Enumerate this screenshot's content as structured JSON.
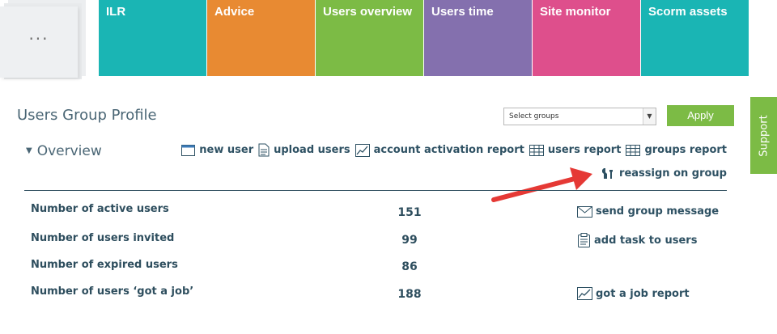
{
  "menu": {
    "dots": "..."
  },
  "tiles": [
    {
      "label": "ILR",
      "color": "#1ab5b4"
    },
    {
      "label": "Advice",
      "color": "#e88a32"
    },
    {
      "label": "Users overview",
      "color": "#7cbb45"
    },
    {
      "label": "Users time",
      "color": "#8470ae"
    },
    {
      "label": "Site monitor",
      "color": "#de4f8c"
    },
    {
      "label": "Scorm assets",
      "color": "#1ab5b4"
    }
  ],
  "header": {
    "title": "Users Group Profile",
    "select_value": "Select groups",
    "apply_label": "Apply",
    "support_label": "Support"
  },
  "overview": {
    "title": "Overview"
  },
  "links": {
    "new_user": "new user",
    "upload_users": "upload users",
    "account_activation_report": "account activation report",
    "users_report": "users report",
    "groups_report": "groups report",
    "reassign_on_group": "reassign on group"
  },
  "stats": [
    {
      "label": "Number of active users",
      "value": "151"
    },
    {
      "label": "Number of users invited",
      "value": "99"
    },
    {
      "label": "Number of expired users",
      "value": "86"
    },
    {
      "label": "Number of users ‘got a job’",
      "value": "188"
    }
  ],
  "actions": {
    "send_group_message": "send group message",
    "add_task_to_users": "add task to users",
    "got_a_job_report": "got a job report"
  },
  "colors": {
    "accent_green": "#7cbb45",
    "text_dark": "#2e4e5e",
    "annotation_arrow": "#e53935"
  }
}
